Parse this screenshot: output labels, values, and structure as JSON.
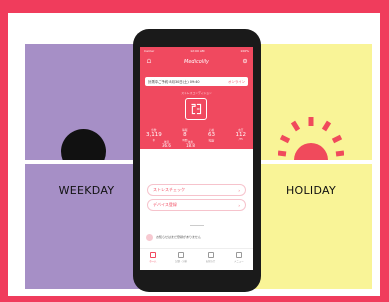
{
  "labels": {
    "weekday": "WEEKDAY",
    "holiday": "HOLIDAY"
  },
  "colors": {
    "frame": "#f03c5c",
    "weekday_panel": "#a68fc6",
    "holiday_panel": "#f9f497",
    "sun": "#f04a5c",
    "app_accent": "#f0495f"
  },
  "app": {
    "status_left": "Carrier",
    "status_time": "12:00 AM",
    "status_right": "100%",
    "title": "Medicolily",
    "date_prefix": "計測中ご予約",
    "date_value": "8月30日(土) 09:40",
    "date_edit": "オンライン",
    "stress_caption": "ストレスコンディション",
    "stats": [
      {
        "label": "歩数",
        "value": "3,119",
        "unit": "歩"
      },
      {
        "label": "睡眠",
        "value": "8",
        "unit": "時間"
      },
      {
        "label": "心拍",
        "value": "63",
        "unit": "拍/分"
      },
      {
        "label": "血圧",
        "value": "112",
        "unit": "/75"
      }
    ],
    "stats2": [
      {
        "label": "体温",
        "value": "36.6",
        "unit": "℃"
      },
      {
        "label": "体重",
        "value": "18.8",
        "unit": "kg"
      },
      {
        "label": "",
        "value": "—",
        "unit": ""
      }
    ],
    "menu_stress_check": "ストレスチェック",
    "menu_device": "デバイス登録",
    "notice_text": "お知らせはまだ登録がありません",
    "tabs": [
      "ホーム",
      "記録・分析",
      "お知らせ",
      "メニュー"
    ]
  }
}
